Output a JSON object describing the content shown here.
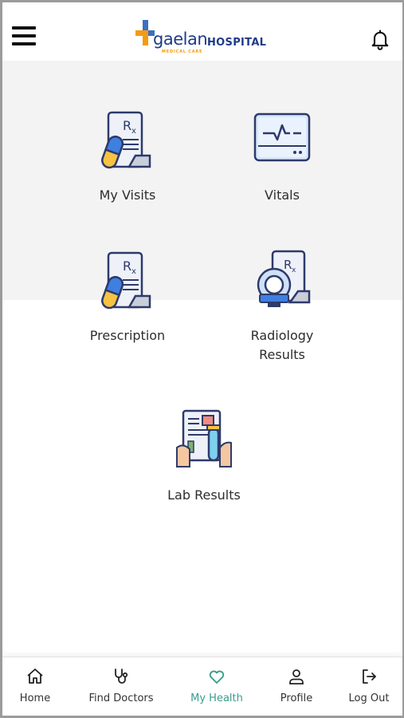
{
  "header": {
    "menu_icon": "hamburger-menu-icon",
    "logo": {
      "name": "gaelan",
      "hospital": "HOSPITAL",
      "tagline": "MEDICAL CARE"
    },
    "bell_icon": "bell-icon"
  },
  "tiles": [
    {
      "label": "My Visits",
      "icon": "prescription-document-icon"
    },
    {
      "label": "Vitals",
      "icon": "heart-monitor-icon"
    },
    {
      "label": "Prescription",
      "icon": "prescription-document-icon"
    },
    {
      "label": "Radiology\nResults",
      "icon": "mri-scanner-report-icon"
    },
    {
      "label": "Lab Results",
      "icon": "lab-report-test-tube-icon"
    }
  ],
  "bottom_nav": {
    "active": "My Health",
    "active_color": "#3a9d8b",
    "items": [
      {
        "label": "Home",
        "icon": "home-icon"
      },
      {
        "label": "Find Doctors",
        "icon": "stethoscope-icon"
      },
      {
        "label": "My Health",
        "icon": "heart-icon"
      },
      {
        "label": "Profile",
        "icon": "user-icon"
      },
      {
        "label": "Log Out",
        "icon": "logout-icon"
      }
    ]
  }
}
